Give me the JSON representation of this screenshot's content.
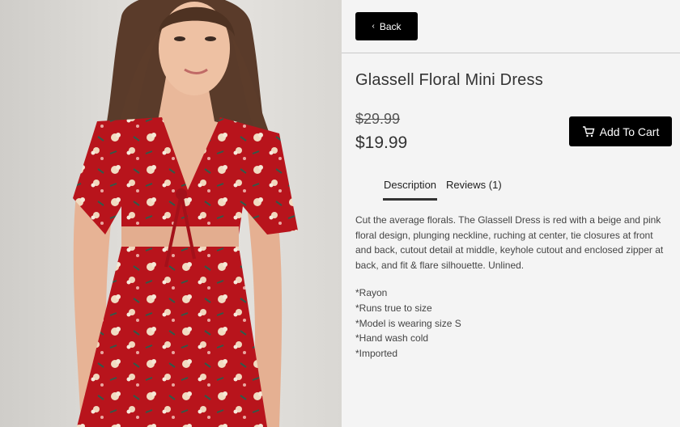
{
  "header": {
    "back_label": "Back"
  },
  "product": {
    "title": "Glassell Floral Mini Dress",
    "old_price": "$29.99",
    "price": "$19.99",
    "add_to_cart_label": "Add To Cart",
    "image_icon": "model-wearing-red-floral-dress",
    "description": "Cut the average florals. The Glassell Dress is red with a beige and pink floral design, plunging neckline, ruching at center, tie closures at front and back, cutout detail at middle, keyhole cutout and enclosed zipper at back, and fit & flare silhouette. Unlined.",
    "details": [
      "*Rayon",
      "*Runs true to size",
      "*Model is wearing size S",
      "*Hand wash cold",
      "*Imported"
    ]
  },
  "tabs": [
    {
      "label": "Description",
      "active": true
    },
    {
      "label": "Reviews (1)",
      "active": false
    }
  ],
  "colors": {
    "button_bg": "#000000",
    "dress_red": "#b8141c",
    "panel_bg": "#f4f4f4"
  }
}
